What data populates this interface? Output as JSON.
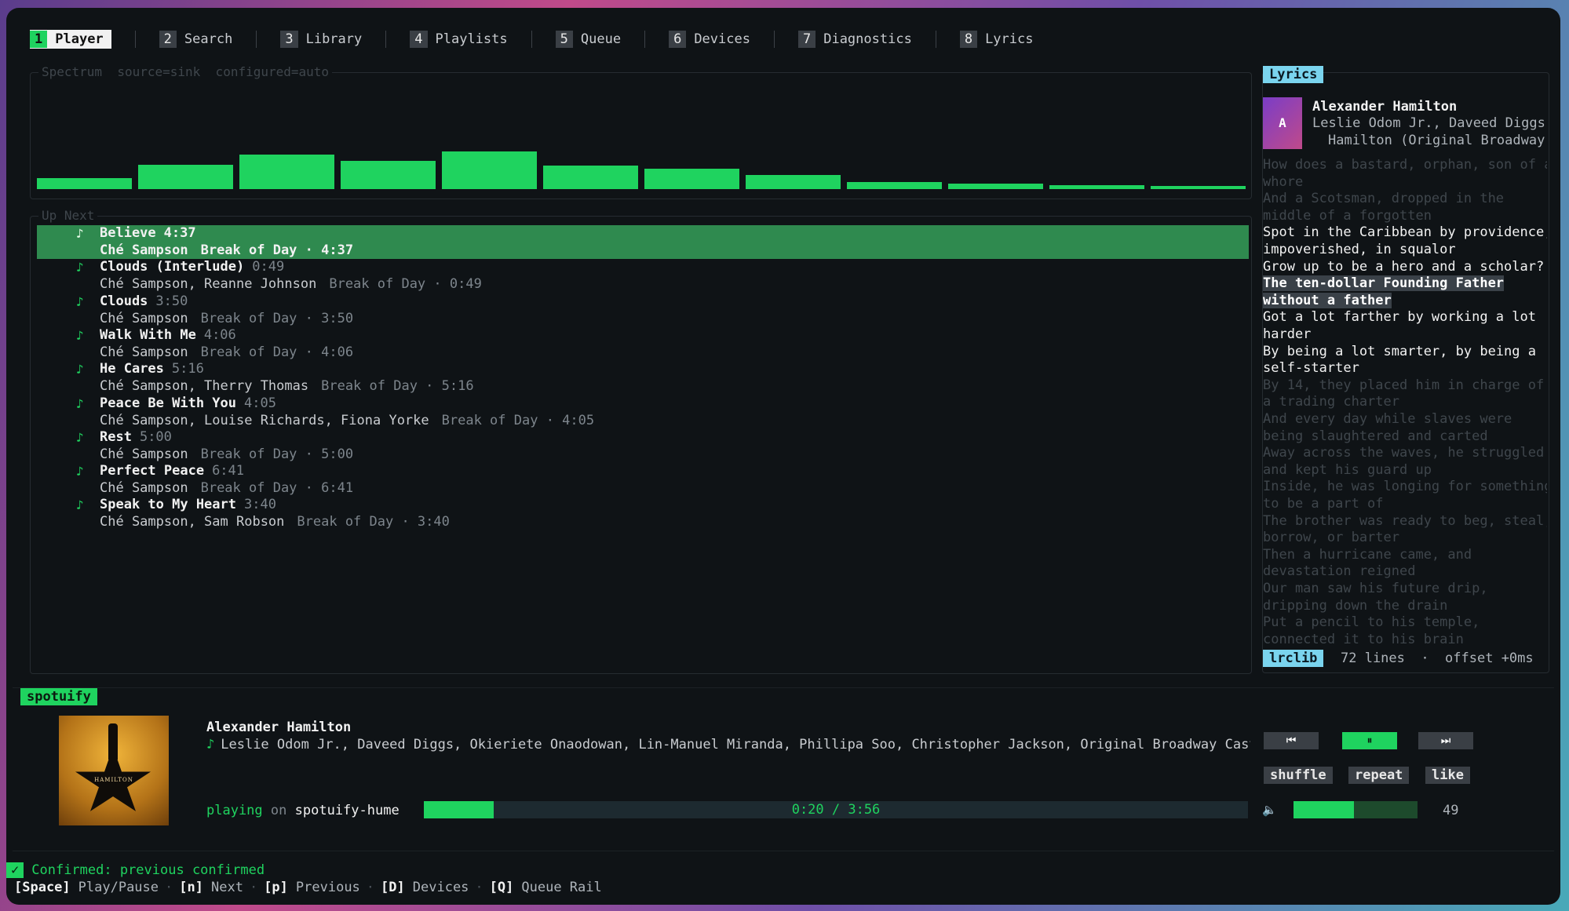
{
  "tabs": [
    {
      "num": "1",
      "label": "Player"
    },
    {
      "num": "2",
      "label": "Search"
    },
    {
      "num": "3",
      "label": "Library"
    },
    {
      "num": "4",
      "label": "Playlists"
    },
    {
      "num": "5",
      "label": "Queue"
    },
    {
      "num": "6",
      "label": "Devices"
    },
    {
      "num": "7",
      "label": "Diagnostics"
    },
    {
      "num": "8",
      "label": "Lyrics"
    }
  ],
  "spectrum": {
    "title": "Spectrum  source=sink  configured=auto",
    "levels": [
      0.11,
      0.24,
      0.34,
      0.28,
      0.37,
      0.23,
      0.2,
      0.14,
      0.07,
      0.05,
      0.04,
      0.03
    ],
    "color": "#1fd35f"
  },
  "upnext": {
    "title": "Up Next",
    "tracks": [
      {
        "title": "Believe",
        "dur": "4:37",
        "artist": "Ché Sampson",
        "album": "Break of Day · 4:37",
        "selected": true
      },
      {
        "title": "Clouds (Interlude)",
        "dur": "0:49",
        "artist": "Ché Sampson, Reanne Johnson",
        "album": "Break of Day · 0:49"
      },
      {
        "title": "Clouds",
        "dur": "3:50",
        "artist": "Ché Sampson",
        "album": "Break of Day · 3:50"
      },
      {
        "title": "Walk With Me",
        "dur": "4:06",
        "artist": "Ché Sampson",
        "album": "Break of Day · 4:06"
      },
      {
        "title": "He Cares",
        "dur": "5:16",
        "artist": "Ché Sampson, Therry Thomas",
        "album": "Break of Day · 5:16"
      },
      {
        "title": "Peace Be With You",
        "dur": "4:05",
        "artist": "Ché Sampson, Louise Richards, Fiona Yorke",
        "album": "Break of Day · 4:05"
      },
      {
        "title": "Rest",
        "dur": "5:00",
        "artist": "Ché Sampson",
        "album": "Break of Day · 5:00"
      },
      {
        "title": "Perfect Peace",
        "dur": "6:41",
        "artist": "Ché Sampson",
        "album": "Break of Day · 6:41"
      },
      {
        "title": "Speak to My Heart",
        "dur": "3:40",
        "artist": "Ché Sampson, Sam Robson",
        "album": "Break of Day · 3:40"
      }
    ]
  },
  "lyrics": {
    "header": "Lyrics",
    "cover_letter": "A",
    "track": "Alexander Hamilton",
    "artists": "Leslie Odom Jr., Daveed Diggs",
    "album": "Hamilton (Original Broadway",
    "lines": [
      {
        "text": "How does a bastard, orphan, son of a",
        "style": "dim"
      },
      {
        "text": "whore",
        "style": "dim"
      },
      {
        "text": "And a Scotsman, dropped in the",
        "style": "dim"
      },
      {
        "text": "middle of a forgotten",
        "style": "dim"
      },
      {
        "text": "Spot in the Caribbean by providence,",
        "style": "bright"
      },
      {
        "text": "impoverished, in squalor",
        "style": "bright"
      },
      {
        "text": "Grow up to be a hero and a scholar?",
        "style": "bright"
      },
      {
        "text": "The ten-dollar Founding Father",
        "style": "hl"
      },
      {
        "text": "without a father",
        "style": "hl"
      },
      {
        "text": "Got a lot farther by working a lot",
        "style": "bright"
      },
      {
        "text": "harder",
        "style": "bright"
      },
      {
        "text": "By being a lot smarter, by being a",
        "style": "bright"
      },
      {
        "text": "self-starter",
        "style": "bright"
      },
      {
        "text": "By 14, they placed him in charge of",
        "style": "dim"
      },
      {
        "text": "a trading charter",
        "style": "dim"
      },
      {
        "text": "And every day while slaves were",
        "style": "dim"
      },
      {
        "text": "being slaughtered and carted",
        "style": "dim"
      },
      {
        "text": "Away across the waves, he struggled",
        "style": "dim"
      },
      {
        "text": "and kept his guard up",
        "style": "dim"
      },
      {
        "text": "Inside, he was longing for something",
        "style": "dim"
      },
      {
        "text": "to be a part of",
        "style": "dim"
      },
      {
        "text": "The brother was ready to beg, steal,",
        "style": "dim"
      },
      {
        "text": "borrow, or barter",
        "style": "dim"
      },
      {
        "text": "Then a hurricane came, and",
        "style": "dim"
      },
      {
        "text": "devastation reigned",
        "style": "dim"
      },
      {
        "text": "Our man saw his future drip,",
        "style": "dim"
      },
      {
        "text": "dripping down the drain",
        "style": "dim"
      },
      {
        "text": "Put a pencil to his temple,",
        "style": "dim"
      },
      {
        "text": "connected it to his brain",
        "style": "dim"
      }
    ],
    "source": "lrclib",
    "footer": "72 lines  ·  offset +0ms"
  },
  "player": {
    "badge": "spotuify",
    "art_text": "HAMILTON",
    "title": "Alexander Hamilton",
    "artists": "Leslie Odom Jr., Daveed Diggs, Okieriete Onaodowan, Lin-Manuel Miranda, Phillipa Soo, Christopher Jackson, Original Broadway Cast …",
    "prev_icon": "⏮",
    "play_icon": "⏸",
    "next_icon": "⏭",
    "shuffle": "shuffle",
    "repeat": "repeat",
    "like": "like",
    "state": "playing",
    "on": "on",
    "device": "spotuify-hume",
    "time": "0:20 / 3:56",
    "progress": 0.085,
    "volume_icon": "🔈",
    "volume_fraction": 0.49,
    "volume": "49"
  },
  "footer": {
    "check": "✓",
    "confirm": "Confirmed: previous confirmed",
    "keys": [
      {
        "key": "[Space]",
        "label": "Play/Pause"
      },
      {
        "key": "[n]",
        "label": "Next"
      },
      {
        "key": "[p]",
        "label": "Previous"
      },
      {
        "key": "[D]",
        "label": "Devices"
      },
      {
        "key": "[Q]",
        "label": "Queue Rail"
      }
    ]
  }
}
